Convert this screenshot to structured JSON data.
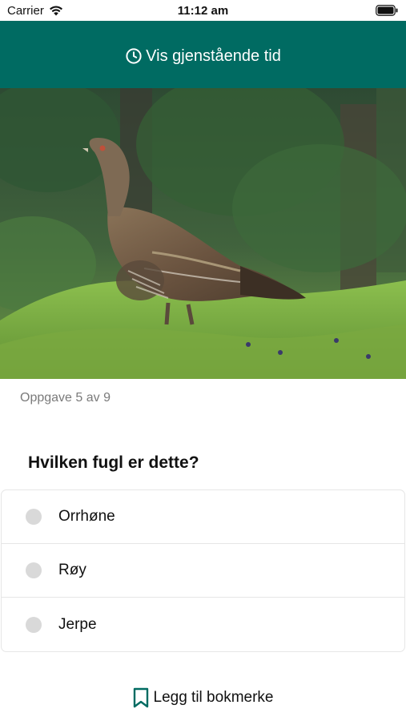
{
  "status_bar": {
    "carrier": "Carrier",
    "time": "11:12 am"
  },
  "header": {
    "remaining_time_label": "Vis gjenstående tid",
    "background_color": "#006b62"
  },
  "image": {
    "subject": "bird-photo"
  },
  "quiz": {
    "progress": "Oppgave 5 av 9",
    "question": "Hvilken fugl er dette?",
    "options": [
      {
        "label": "Orrhøne"
      },
      {
        "label": "Røy"
      },
      {
        "label": "Jerpe"
      }
    ]
  },
  "footer": {
    "bookmark_label": "Legg til bokmerke"
  }
}
